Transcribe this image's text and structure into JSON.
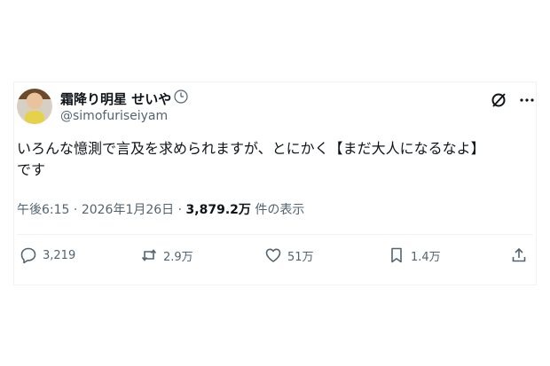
{
  "author": {
    "display_name": "霜降り明星 せいや",
    "handle": "@simofuriseiyam",
    "badge_icon": "clock-icon"
  },
  "tweet": {
    "text": "いろんな憶測で言及を求められますが、とにかく【まだ大人になるなよ】\nです",
    "time": "午後6:15",
    "separator1": " · ",
    "date": "2026年1月26日",
    "separator2": " · ",
    "views_count": "3,879.2万",
    "views_label": " 件の表示"
  },
  "actions": {
    "replies": "3,219",
    "reposts": "2.9万",
    "likes": "51万",
    "bookmarks": "1.4万"
  },
  "icons": {
    "header": [
      "grok-icon",
      "more-icon"
    ],
    "actions": [
      "reply-icon",
      "repost-icon",
      "like-icon",
      "bookmark-icon",
      "share-icon"
    ]
  },
  "colors": {
    "text": "#0f1419",
    "secondary": "#536471",
    "border": "#eff3f4"
  }
}
